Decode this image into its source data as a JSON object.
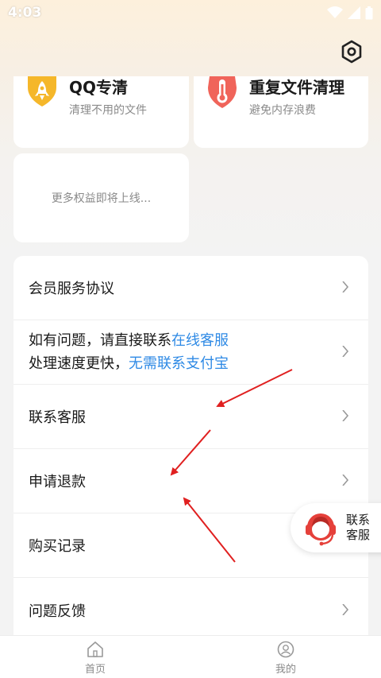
{
  "status_bar": {
    "time": "4:03"
  },
  "features": [
    {
      "title": "QQ专清",
      "subtitle": "清理不用的文件",
      "icon": "rocket-icon",
      "color": "#f5b72a"
    },
    {
      "title": "重复文件清理",
      "subtitle": "避免内存浪费",
      "icon": "thermometer-icon",
      "color": "#f0645a"
    }
  ],
  "more_card": {
    "text": "更多权益即将上线..."
  },
  "menu": {
    "agreement": "会员服务协议",
    "help_line1_prefix": "如有问题，请直接联系",
    "help_line1_link": "在线客服",
    "help_line2_prefix": "处理速度更快，",
    "help_line2_link": "无需联系支付宝",
    "contact": "联系客服",
    "refund": "申请退款",
    "purchase_history": "购买记录",
    "feedback": "问题反馈"
  },
  "floating_service": {
    "label": "联系客服"
  },
  "bottom_nav": {
    "home": "首页",
    "mine": "我的"
  },
  "colors": {
    "link": "#2f8ae5",
    "annotation_arrow": "#e02020"
  }
}
